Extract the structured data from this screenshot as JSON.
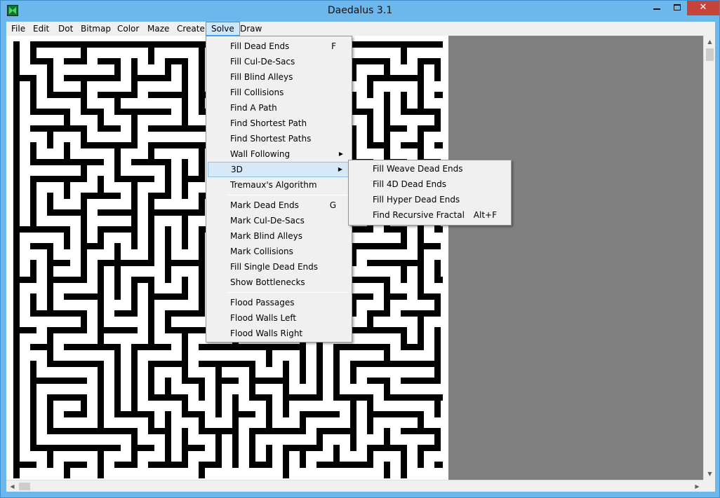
{
  "window": {
    "title": "Daedalus 3.1",
    "icon": "daedalus-app-icon",
    "controls": {
      "minimize": "minimize",
      "maximize": "maximize",
      "close": "✕"
    }
  },
  "menubar": {
    "items": [
      "File",
      "Edit",
      "Dot",
      "Bitmap",
      "Color",
      "Maze",
      "Create",
      "Solve",
      "Draw"
    ],
    "active": "Solve"
  },
  "solve_menu": {
    "items": [
      {
        "label": "Fill Dead Ends",
        "shortcut": "F"
      },
      {
        "label": "Fill Cul-De-Sacs",
        "shortcut": ""
      },
      {
        "label": "Fill Blind Alleys",
        "shortcut": ""
      },
      {
        "label": "Fill Collisions",
        "shortcut": ""
      },
      {
        "label": "Find A Path",
        "shortcut": ""
      },
      {
        "label": "Find Shortest Path",
        "shortcut": ""
      },
      {
        "label": "Find Shortest Paths",
        "shortcut": ""
      },
      {
        "label": "Wall Following",
        "shortcut": "",
        "submenu": true
      },
      {
        "label": "3D",
        "shortcut": "",
        "submenu": true,
        "highlighted": true
      },
      {
        "label": "Tremaux's Algorithm",
        "shortcut": ""
      },
      {
        "label": "Mark Dead Ends",
        "shortcut": "G"
      },
      {
        "label": "Mark Cul-De-Sacs",
        "shortcut": ""
      },
      {
        "label": "Mark Blind Alleys",
        "shortcut": ""
      },
      {
        "label": "Mark Collisions",
        "shortcut": ""
      },
      {
        "label": "Fill Single Dead Ends",
        "shortcut": ""
      },
      {
        "label": "Show Bottlenecks",
        "shortcut": ""
      },
      {
        "label": "Flood Passages",
        "shortcut": ""
      },
      {
        "label": "Flood Walls Left",
        "shortcut": ""
      },
      {
        "label": "Flood Walls Right",
        "shortcut": ""
      }
    ]
  },
  "submenu_3d": {
    "items": [
      {
        "label": "Fill Weave Dead Ends",
        "shortcut": ""
      },
      {
        "label": "Fill 4D Dead Ends",
        "shortcut": ""
      },
      {
        "label": "Fill Hyper Dead Ends",
        "shortcut": ""
      },
      {
        "label": "Find Recursive Fractal",
        "shortcut": "Alt+F"
      }
    ]
  },
  "icons": {
    "submenu_arrow": "▶",
    "scroll_up": "▲",
    "scroll_down": "▼",
    "scroll_left": "◀",
    "scroll_right": "▶"
  },
  "colors": {
    "maze_wall": "#000000",
    "maze_passage": "#ffffff",
    "background": "#808080",
    "menu_highlight": "#d6e9f8"
  }
}
